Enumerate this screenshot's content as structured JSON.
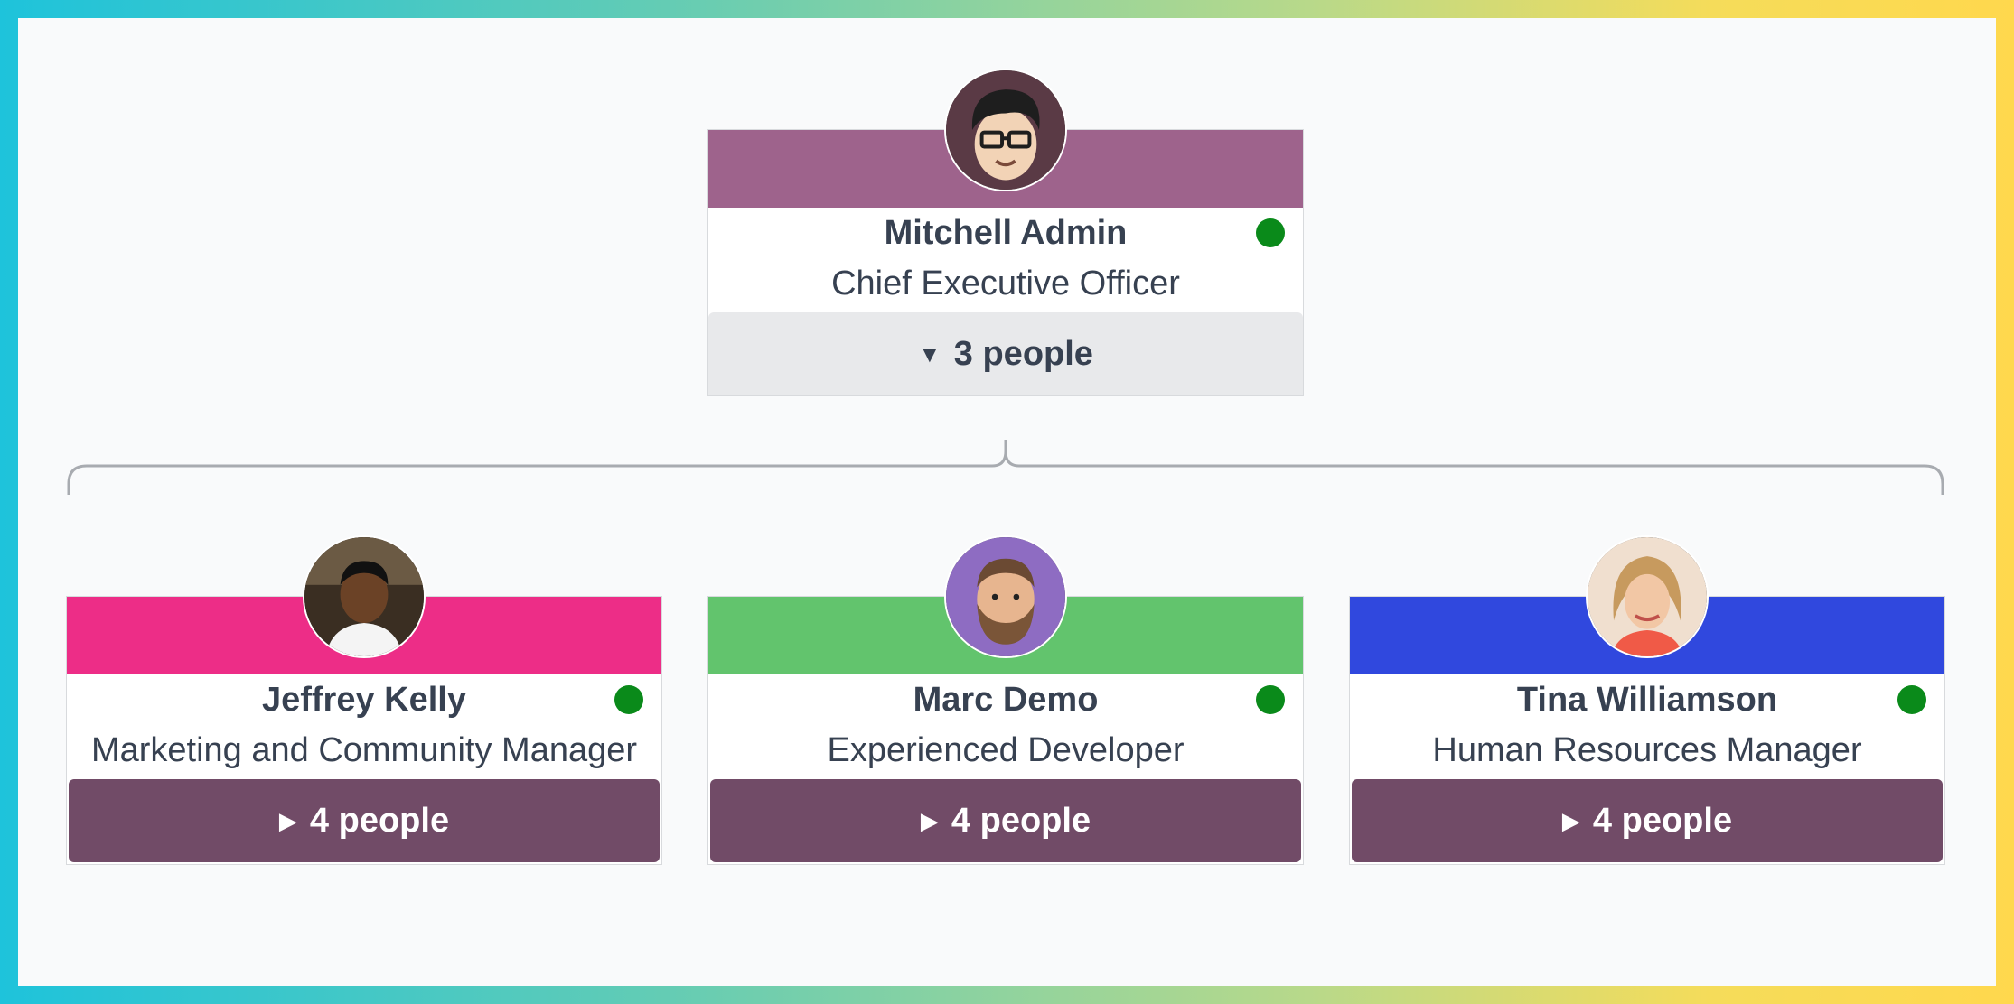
{
  "manager": {
    "name": "Mitchell Admin",
    "job_title": "Chief Executive Officer",
    "band_color": "#9e638c",
    "status": "online",
    "avatar_icon": "cartoon-man-glasses-avatar",
    "team_toggle": {
      "caret": "▼",
      "label": "3 people",
      "expanded": true
    }
  },
  "reports": [
    {
      "name": "Jeffrey Kelly",
      "job_title": "Marketing and Community Manager",
      "band_color": "#ed2d87",
      "status": "online",
      "avatar_icon": "photo-man-avatar",
      "team_toggle": {
        "caret": "▶",
        "label": "4 people",
        "expanded": false
      }
    },
    {
      "name": "Marc Demo",
      "job_title": "Experienced Developer",
      "band_color": "#62c46d",
      "status": "online",
      "avatar_icon": "cartoon-bearded-man-avatar",
      "team_toggle": {
        "caret": "▶",
        "label": "4 people",
        "expanded": false
      }
    },
    {
      "name": "Tina Williamson",
      "job_title": "Human Resources Manager",
      "band_color": "#3048de",
      "status": "online",
      "avatar_icon": "photo-woman-avatar",
      "team_toggle": {
        "caret": "▶",
        "label": "4 people",
        "expanded": false
      }
    }
  ],
  "colors": {
    "status_online": "#0a8a1a",
    "toggle_collapsed_bg": "#714b67",
    "toggle_expanded_bg": "#e8e9eb"
  }
}
